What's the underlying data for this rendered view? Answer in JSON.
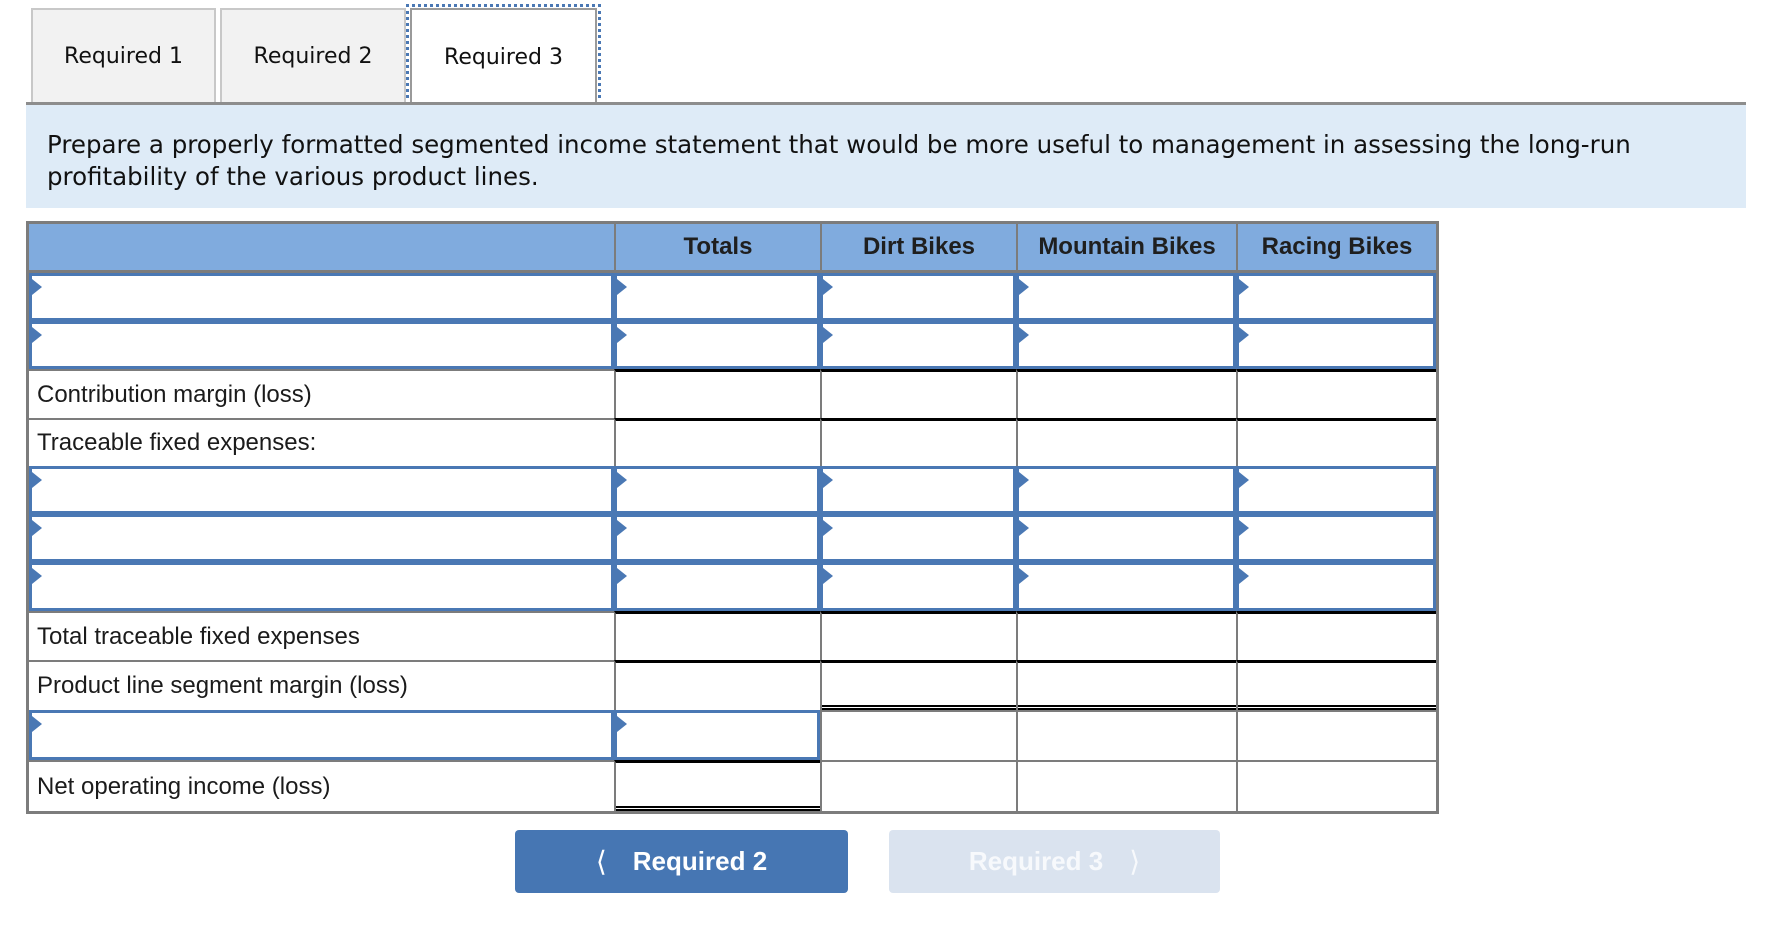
{
  "tabs": [
    {
      "label": "Required 1",
      "active": false
    },
    {
      "label": "Required 2",
      "active": false
    },
    {
      "label": "Required 3",
      "active": true
    }
  ],
  "instructions": "Prepare a properly formatted segmented income statement that would be more useful to management in assessing the long-run profitability of the various product lines.",
  "table": {
    "columns": [
      "",
      "Totals",
      "Dirt Bikes",
      "Mountain Bikes",
      "Racing Bikes"
    ],
    "rows": [
      {
        "type": "input",
        "label": "",
        "values": [
          "",
          "",
          "",
          ""
        ]
      },
      {
        "type": "input",
        "label": "",
        "values": [
          "",
          "",
          "",
          ""
        ]
      },
      {
        "type": "label",
        "label": "Contribution margin (loss)",
        "values": [
          "",
          "",
          "",
          ""
        ]
      },
      {
        "type": "label",
        "label": "Traceable fixed expenses:",
        "values": [
          "",
          "",
          "",
          ""
        ]
      },
      {
        "type": "input",
        "label": "",
        "values": [
          "",
          "",
          "",
          ""
        ]
      },
      {
        "type": "input",
        "label": "",
        "values": [
          "",
          "",
          "",
          ""
        ]
      },
      {
        "type": "input",
        "label": "",
        "values": [
          "",
          "",
          "",
          ""
        ]
      },
      {
        "type": "label",
        "label": "Total traceable fixed expenses",
        "values": [
          "",
          "",
          "",
          ""
        ]
      },
      {
        "type": "label",
        "label": "Product line segment margin (loss)",
        "values": [
          "",
          "",
          "",
          ""
        ]
      },
      {
        "type": "input-totals-only",
        "label": "",
        "values": [
          "",
          "",
          "",
          ""
        ]
      },
      {
        "type": "label",
        "label": "Net operating income (loss)",
        "values": [
          "",
          "",
          "",
          ""
        ]
      }
    ]
  },
  "nav": {
    "prev_label": "Required 2",
    "next_label": "Required 3",
    "prev_icon": "chevron-left-icon",
    "next_icon": "chevron-right-icon",
    "next_enabled": false
  },
  "colors": {
    "accent": "#4676b3",
    "header_bg": "#80abde",
    "instruction_bg": "#deebf7",
    "disabled_button": "#dae3ef"
  }
}
